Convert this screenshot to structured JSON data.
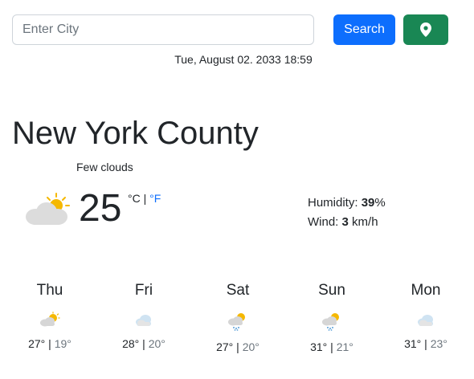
{
  "search": {
    "placeholder": "Enter City",
    "button_label": "Search",
    "location_icon": "map-marker-icon"
  },
  "datetime": "Tue, August 02. 2033 18:59",
  "current": {
    "city": "New York County",
    "description": "Few clouds",
    "icon": "few-clouds-icon",
    "temperature": "25",
    "unit_c": "°C",
    "unit_sep": " | ",
    "unit_f": "°F",
    "humidity_label": "Humidity: ",
    "humidity_value": "39",
    "humidity_unit": "%",
    "wind_label": "Wind: ",
    "wind_value": "3",
    "wind_unit": " km/h"
  },
  "forecast": [
    {
      "day": "Thu",
      "icon": "sun-cloud-icon",
      "high": "27°",
      "sep": " | ",
      "low": "19°"
    },
    {
      "day": "Fri",
      "icon": "cloud-icon",
      "high": "28°",
      "sep": " | ",
      "low": "20°"
    },
    {
      "day": "Sat",
      "icon": "sun-cloud-rain-icon",
      "high": "27°",
      "sep": " | ",
      "low": "20°"
    },
    {
      "day": "Sun",
      "icon": "sun-cloud-rain-icon",
      "high": "31°",
      "sep": " | ",
      "low": "21°"
    },
    {
      "day": "Mon",
      "icon": "cloud-icon",
      "high": "31°",
      "sep": " | ",
      "low": "23°"
    }
  ],
  "colors": {
    "primary": "#0d6efd",
    "success": "#198754",
    "sun": "#f5b800",
    "cloud": "#d8d8d8"
  }
}
